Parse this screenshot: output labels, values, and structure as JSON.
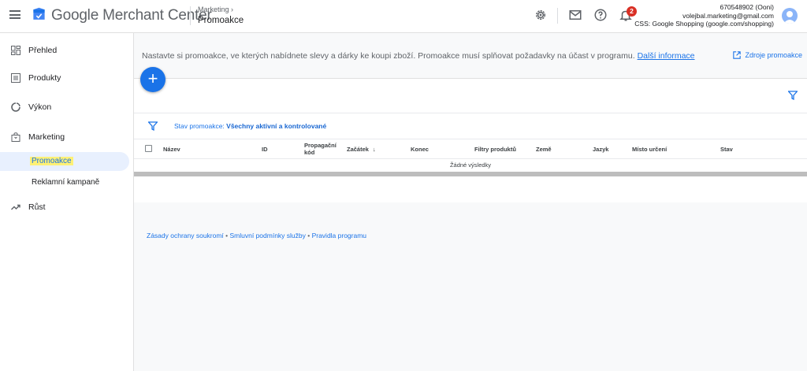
{
  "app": {
    "title": "Google Merchant Center"
  },
  "breadcrumb": {
    "parent": "Marketing",
    "current": "Promoakce"
  },
  "header": {
    "notifications_count": "2",
    "account": {
      "id_line": "670548902 (Ooni)",
      "email": "volejbal.marketing@gmail.com",
      "css_line": "CSS: Google Shopping (google.com/shopping)"
    }
  },
  "sidebar": {
    "items": [
      {
        "label": "Přehled",
        "icon": "dashboard-icon"
      },
      {
        "label": "Produkty",
        "icon": "list-icon"
      },
      {
        "label": "Výkon",
        "icon": "performance-icon"
      },
      {
        "label": "Marketing",
        "icon": "bag-icon"
      }
    ],
    "marketing_sub": [
      {
        "label": "Promoakce",
        "active": true
      },
      {
        "label": "Reklamní kampaně",
        "active": false
      }
    ],
    "growth": {
      "label": "Růst",
      "icon": "trending-up-icon"
    }
  },
  "main": {
    "intro_text": "Nastavte si promoakce, ve kterých nabídnete slevy a dárky ke koupi zboží. Promoakce musí splňovat požadavky na účast v programu.",
    "intro_link": "Další informace",
    "sources_link": "Zdroje promoakce",
    "add_button": "+",
    "filter": {
      "prefix": "Stav promoakce:",
      "value": "Všechny aktivní a kontrolované"
    },
    "table": {
      "columns": {
        "name": "Název",
        "id": "ID",
        "promo_code_1": "Propagační",
        "promo_code_2": "kód",
        "start": "Začátek",
        "end": "Konec",
        "product_filters": "Filtry produktů",
        "country": "Země",
        "language": "Jazyk",
        "destination": "Místo určení",
        "status": "Stav"
      },
      "empty_text": "Žádné výsledky"
    }
  },
  "footer": {
    "privacy": "Zásady ochrany soukromí",
    "terms": "Smluvní podmínky služby",
    "program": "Pravidla programu",
    "separator": " • "
  },
  "colors": {
    "accent": "#1a73e8",
    "highlight": "#fff176",
    "badge": "#d93025"
  }
}
